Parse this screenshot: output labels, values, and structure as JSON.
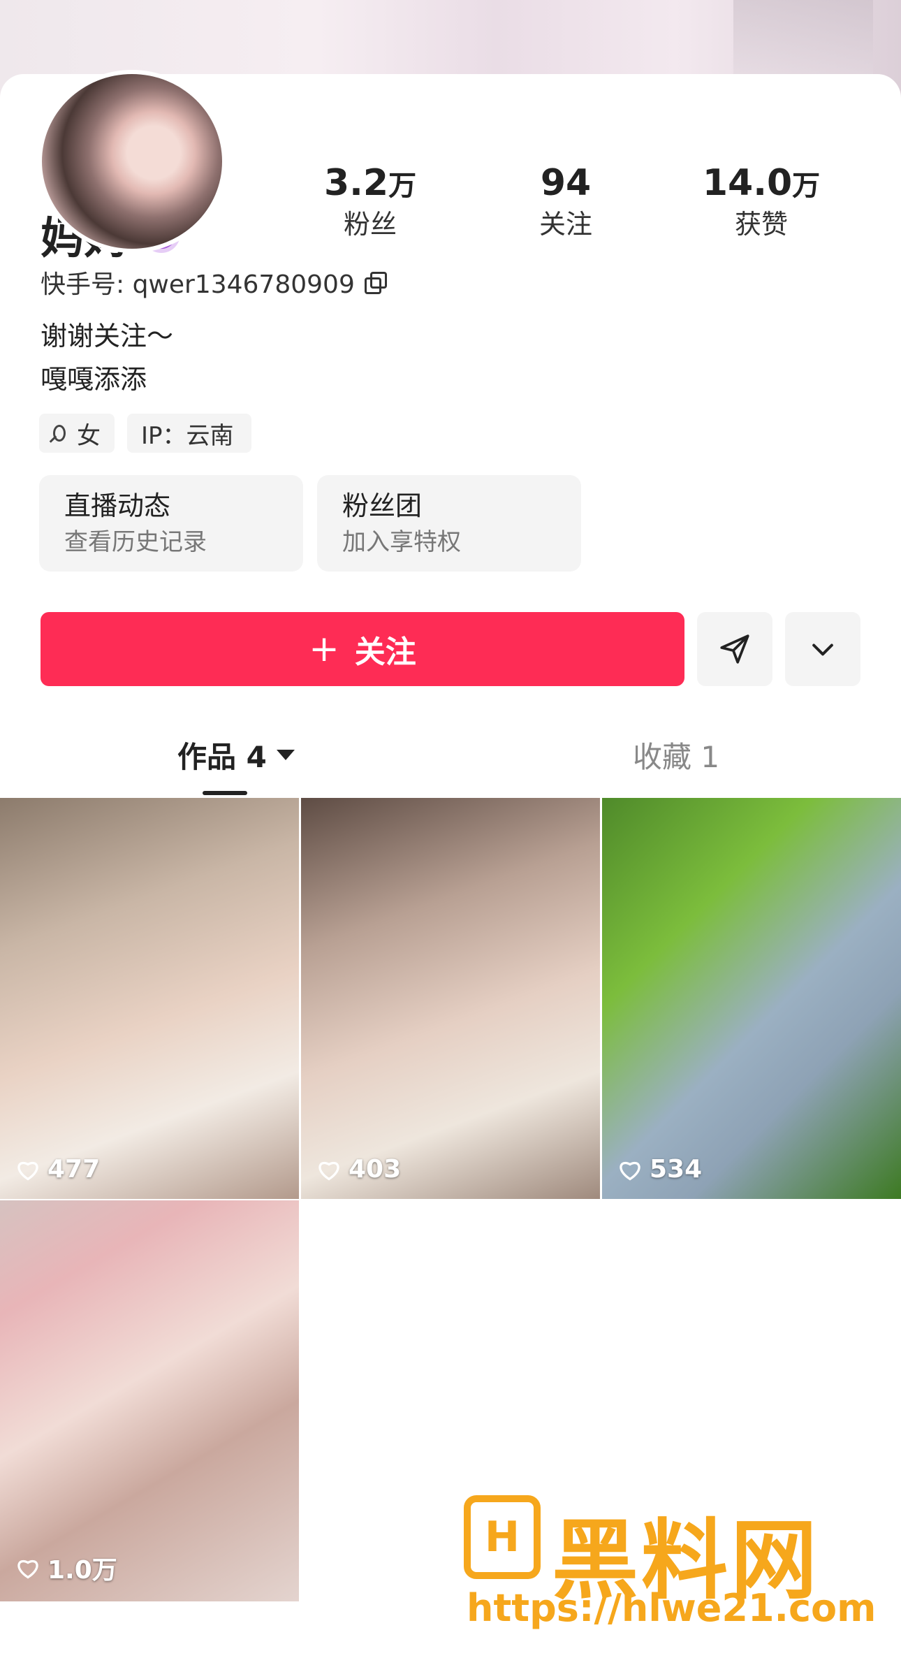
{
  "profile": {
    "name": "妈妈",
    "kuaishou_id": "快手号: qwer1346780909",
    "bio_line1": "谢谢关注～",
    "bio_line2": "嘎嘎添添",
    "gender_tag": "女",
    "ip_tag": "IP：云南"
  },
  "stats": [
    {
      "num": "3.2",
      "unit": "万",
      "label": "粉丝"
    },
    {
      "num": "94",
      "unit": "",
      "label": "关注"
    },
    {
      "num": "14.0",
      "unit": "万",
      "label": "获赞"
    }
  ],
  "cards": [
    {
      "title": "直播动态",
      "sub": "查看历史记录"
    },
    {
      "title": "粉丝团",
      "sub": "加入享特权"
    }
  ],
  "actions": {
    "follow_label": "关注",
    "follow_plus": "+",
    "accent": "#fe2c55"
  },
  "tabs": {
    "works": "作品 4",
    "favorites": "收藏 1"
  },
  "posts": [
    {
      "likes": "477"
    },
    {
      "likes": "403"
    },
    {
      "likes": "534"
    },
    {
      "likes": "1.0万"
    }
  ],
  "watermark": {
    "title": "黑料网",
    "url": "https://hlwe21.com",
    "color": "#f6a71c"
  }
}
